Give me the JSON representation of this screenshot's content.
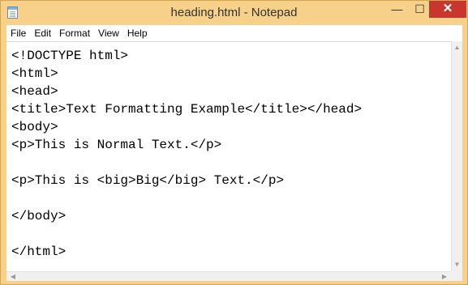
{
  "window": {
    "title": "heading.html - Notepad",
    "minimize_glyph": "—",
    "maximize_glyph": "☐",
    "close_glyph": "✕"
  },
  "menu": [
    "File",
    "Edit",
    "Format",
    "View",
    "Help"
  ],
  "editor": {
    "lines": [
      "<!DOCTYPE html>",
      "<html>",
      "<head>",
      "<title>Text Formatting Example</title></head>",
      "<body>",
      "<p>This is Normal Text.</p>",
      "",
      "<p>This is <big>Big</big> Text.</p>",
      "",
      "</body>",
      "",
      "</html>"
    ]
  },
  "icons": {
    "app": "notepad-icon",
    "scroll_up": "scroll-up-arrow-icon",
    "scroll_down": "scroll-down-arrow-icon",
    "scroll_left": "scroll-left-arrow-icon",
    "scroll_right": "scroll-right-arrow-icon"
  },
  "colors": {
    "titlebar": "#f7d18a",
    "close_button": "#c7372e"
  }
}
